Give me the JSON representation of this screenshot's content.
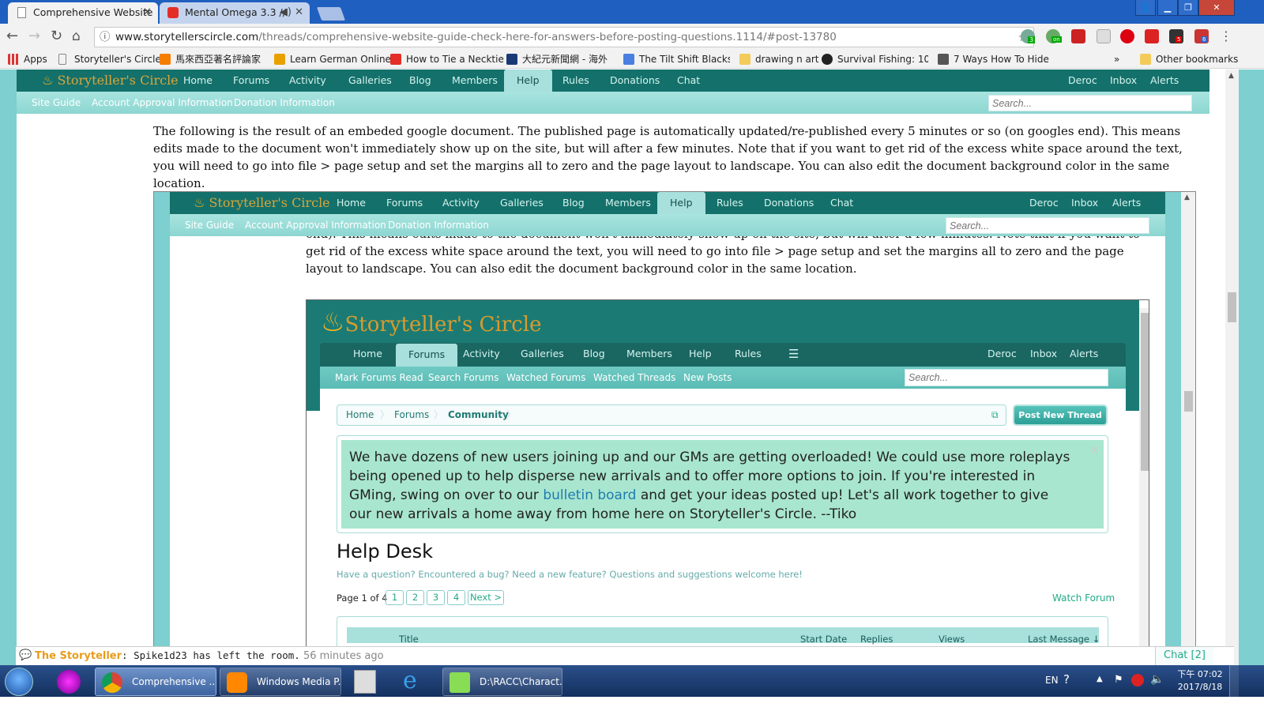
{
  "browser": {
    "tabs": [
      {
        "title": "Comprehensive Website",
        "active": true
      },
      {
        "title": "Mental Omega 3.3 //",
        "active": false
      }
    ],
    "url_host": "www.storytellerscircle.com",
    "url_path": "/threads/comprehensive-website-guide-check-here-for-answers-before-posting-questions.1114/#post-13780",
    "extension_badges": [
      "3",
      "on",
      "5",
      "6"
    ],
    "bookmarks": [
      "Apps",
      "Storyteller's Circle",
      "馬來西亞著名評論家",
      "Learn German Online",
      "How to Tie a Necktie",
      "大紀元新聞網 - 海外",
      "The Tilt Shift Blacksm",
      "drawing n art",
      "Survival Fishing: 10 W",
      "7 Ways How To Hide"
    ],
    "bookmarks_overflow": "»",
    "other_bookmarks": "Other bookmarks"
  },
  "site": {
    "logo": "Storyteller's Circle",
    "nav": [
      "Home",
      "Forums",
      "Activity",
      "Galleries",
      "Blog",
      "Members",
      "Help",
      "Rules",
      "Donations",
      "Chat"
    ],
    "nav_selected": "Help",
    "user_links": [
      "Deroc",
      "Inbox",
      "Alerts"
    ],
    "subnav": [
      "Site Guide",
      "Account Approval Information",
      "Donation Information"
    ],
    "search_placeholder": "Search...",
    "intro_text": "The following is the result of an embeded google document. The published page is automatically updated/re-published every 5 minutes or so (on googles end). This means edits made to the document won't immediately show up on the site, but will after a few minutes. Note that if you want to get rid of the excess white space around the text, you will need to go into file > page setup and set the margins all to zero and the page layout to landscape. You can also edit the document background color in the same location.",
    "nested_text_partial": "end). This means edits made to the document won't immediately show up on the site, but will after a few minutes. Note that if you want to get rid of the excess white space around the text, you will need to go into file > page setup and set the margins all to zero and the page layout to landscape. You can also edit the document background color in the same location."
  },
  "inner": {
    "nav": [
      "Home",
      "Forums",
      "Activity",
      "Galleries",
      "Blog",
      "Members",
      "Help",
      "Rules"
    ],
    "nav_selected": "Forums",
    "subnav": [
      "Mark Forums Read",
      "Search Forums",
      "Watched Forums",
      "Watched Threads",
      "New Posts"
    ],
    "breadcrumb": [
      "Home",
      "Forums",
      "Community"
    ],
    "post_new_thread": "Post New Thread",
    "notice_before": "We have dozens of new users joining up and our GMs are getting overloaded! We could use more roleplays being opened up to help disperse new arrivals and to offer more options to join. If you're interested in GMing, swing on over to our ",
    "notice_link": "bulletin board",
    "notice_after": " and get your ideas posted up! Let's all work together to give our new arrivals a home away from home here on Storyteller's Circle. --Tiko",
    "notice_close": "×",
    "forum_title": "Help Desk",
    "forum_desc": "Have a question? Encountered a bug? Need a new feature? Questions and suggestions welcome here!",
    "page_label": "Page 1 of 4",
    "pages": [
      "1",
      "2",
      "3",
      "4"
    ],
    "next": "Next >",
    "watch_forum": "Watch Forum",
    "columns": [
      "Title",
      "Start Date",
      "Replies",
      "Views",
      "Last Message ↓"
    ]
  },
  "chat": {
    "user": "The Storyteller",
    "message": ": Spike1d23 has left the room.",
    "time": "56 minutes ago",
    "chat_button": "Chat [2]"
  },
  "taskbar": {
    "items": [
      "Comprehensive ...",
      "Windows Media P...",
      "D:\\RACC\\Charact..."
    ],
    "lang": "EN",
    "time": "下午 07:02",
    "date": "2017/8/18"
  }
}
